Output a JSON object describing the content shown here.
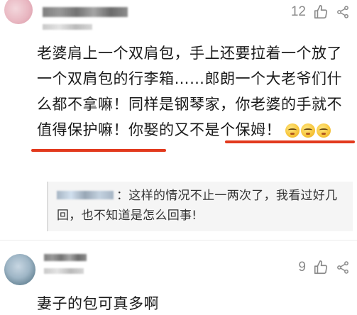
{
  "comments": [
    {
      "like_count": "12",
      "text_before": "老婆肩上一个双肩包，手上还要拉着一个放了一个双肩包的行李箱……郎朗一个大老爷们什么都不拿嘛！同样是钢琴家，你老婆的手就不值得保护嘛！",
      "text_highlight": "你娶的又不是个保姆！",
      "reply": {
        "text": "：这样的情况不止一两次了，我看过好几回，也不知道是怎么回事!"
      }
    },
    {
      "like_count": "9",
      "text": "妻子的包可真多啊"
    }
  ],
  "icons": {
    "like": "thumbs-up-icon",
    "share": "share-icon",
    "emoji": "pouting-face-emoji"
  },
  "colors": {
    "highlight_underline": "#e2391d",
    "meta_gray": "#8a8a8a"
  }
}
